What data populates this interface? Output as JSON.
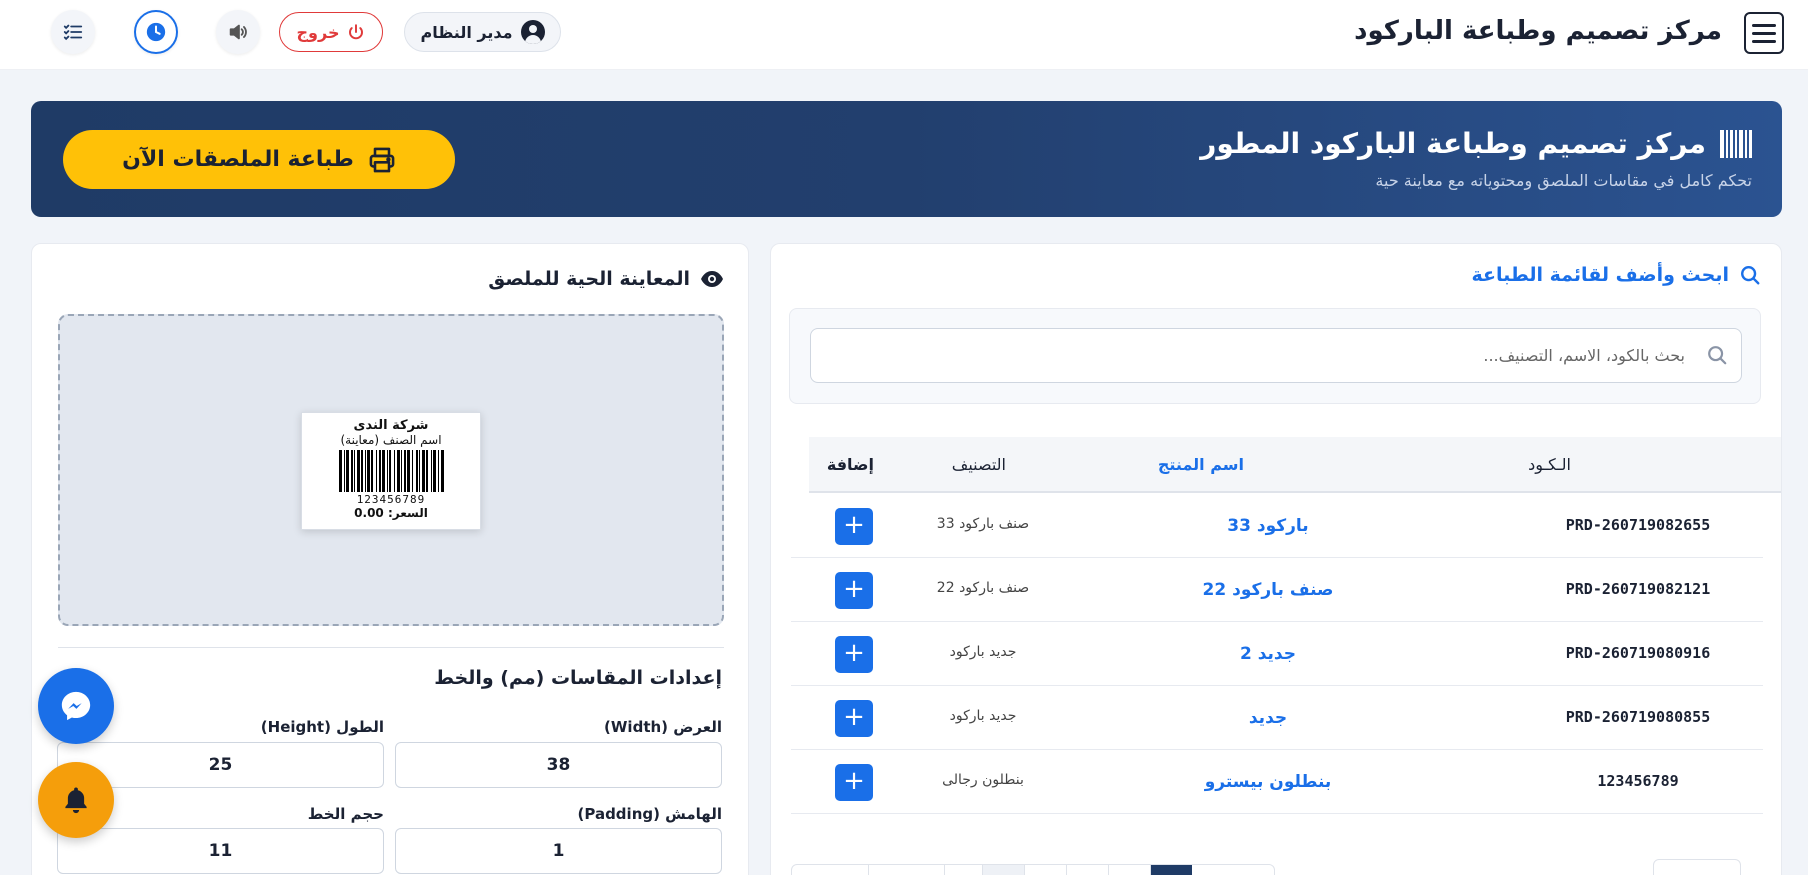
{
  "header": {
    "title": "مركز تصميم وطباعة الباركود",
    "user_label": "مدير النظام",
    "logout_label": "خروج",
    "icons": [
      "menu-icon",
      "user-icon",
      "power-icon",
      "speaker-icon",
      "clock-icon",
      "checklist-icon"
    ]
  },
  "hero": {
    "title": "مركز تصميم وطباعة الباركود المطور",
    "subtitle": "تحكم كامل في مقاسات الملصق ومحتوياته مع معاينة حية",
    "print_label": "طباعة الملصقات الآن"
  },
  "search_panel": {
    "title": "ابحث وأضف لقائمة الطباعة",
    "placeholder": "بحث بالكود، الاسم، التصنيف...",
    "value": ""
  },
  "table": {
    "columns": {
      "code": "الـكـود",
      "name": "اسم المنتج",
      "category": "التصنيف",
      "add": "إضافة"
    },
    "add_symbol": "+",
    "rows": [
      {
        "code": "PRD-260719082655",
        "name": "باركود 33",
        "category": "صنف باركود 33"
      },
      {
        "code": "PRD-260719082121",
        "name": "صنف باركود 22",
        "category": "صنف باركود 22"
      },
      {
        "code": "PRD-260719080916",
        "name": "جديد 2",
        "category": "جديد باركود"
      },
      {
        "code": "PRD-260719080855",
        "name": "جديد",
        "category": "جديد باركود"
      },
      {
        "code": "123456789",
        "name": "بنطلون بيسترو",
        "category": "بنطلون رجالى"
      }
    ]
  },
  "preview": {
    "title": "المعاينة الحية للملصق",
    "label": {
      "company": "شركة الندى",
      "item": "اسم الصنف (معاينة)",
      "number": "123456789",
      "price": "السعر: 0.00"
    }
  },
  "dimensions": {
    "title": "إعدادات المقاسات (مم) والخط",
    "width_label": "العرض (Width)",
    "width_value": "38",
    "height_label": "الطول (Height)",
    "height_value": "25",
    "padding_label": "الهامش (Padding)",
    "padding_value": "1",
    "font_label": "حجم الخط",
    "font_value": "11"
  },
  "colors": {
    "primary": "#1a6fe8",
    "hero_dark": "#1f3b66",
    "print_button": "#ffc107",
    "logout": "#e03a3a",
    "bell": "#f59e0b"
  }
}
